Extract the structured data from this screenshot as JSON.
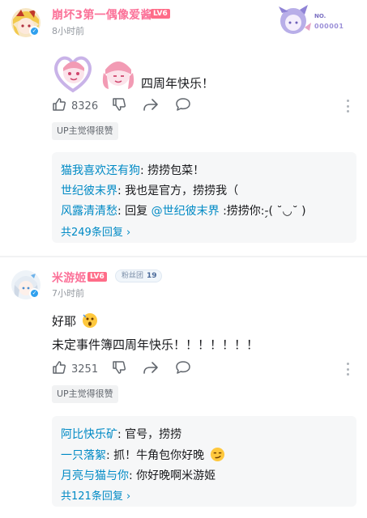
{
  "comments": [
    {
      "username": "崩坏3第一偶像爱酱",
      "level": "LV6",
      "time": "8小时前",
      "badge_text": "NO.",
      "badge_number": "000001",
      "content_lines": [
        "四周年快乐！"
      ],
      "likes": "8326",
      "up_liked": "UP主觉得很赞",
      "replies": [
        {
          "name": "猫我喜欢还有狗",
          "text": ": 捞捞包菜！"
        },
        {
          "name": "世纪彼末界",
          "text": ": 我也是官方，捞捞我（"
        },
        {
          "name": "风露清清愁",
          "text": ": 回复 ",
          "mention": "@世纪彼末界",
          "text2": " :捞捞你:-̗( ˘◡˘ )"
        }
      ],
      "more_replies": "共249条回复 ›"
    },
    {
      "username": "米游姬",
      "level": "LV6",
      "fan_badge": "粉丝团",
      "fan_level": "19",
      "time": "7小时前",
      "content_lines": [
        "好耶",
        "未定事件簿四周年快乐！！！！！！！"
      ],
      "likes": "3251",
      "up_liked": "UP主觉得很赞",
      "replies": [
        {
          "name": "阿比快乐矿",
          "text": ": 官号，捞捞"
        },
        {
          "name": "一只落絮",
          "text": ": 抓！牛角包你好晚"
        },
        {
          "name": "月亮与猫与你",
          "text": ": 你好晚啊米游姬"
        }
      ],
      "more_replies": "共121条回复 ›"
    }
  ],
  "colors": {
    "username": "#fb7299",
    "link": "#008ac5",
    "level_badge": "#ff6c88"
  }
}
